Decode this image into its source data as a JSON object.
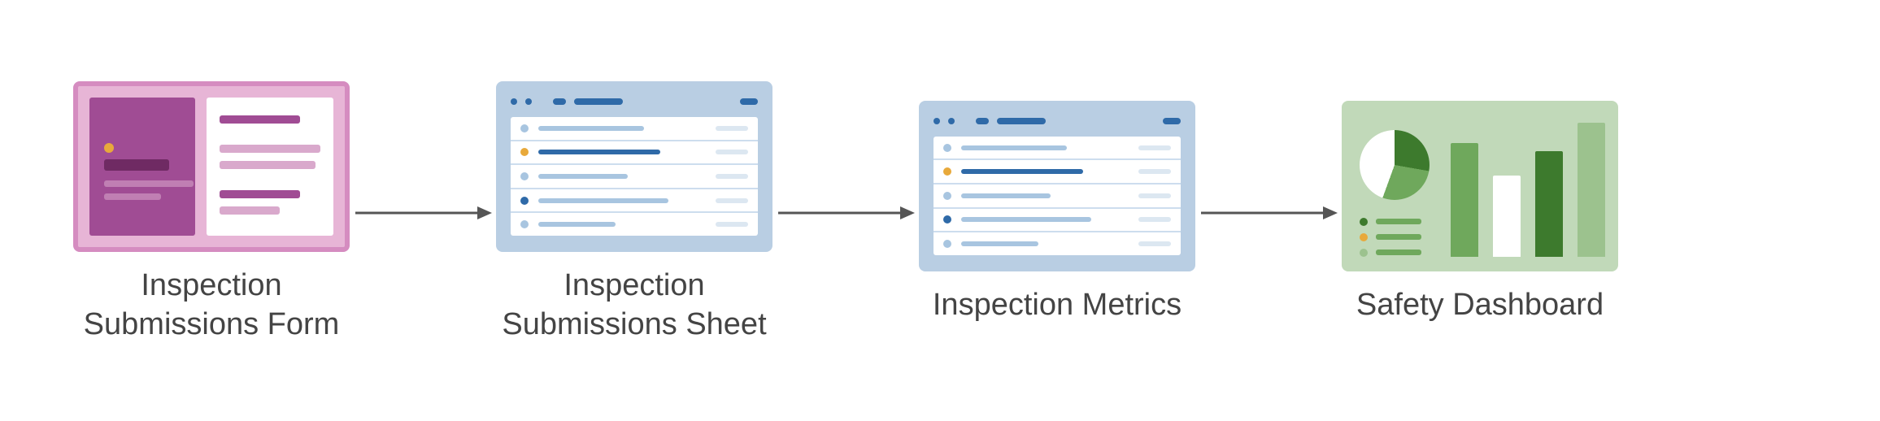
{
  "flow": {
    "nodes": [
      {
        "id": "form",
        "label": "Inspection\nSubmissions Form",
        "icon": "form-icon"
      },
      {
        "id": "sheet",
        "label": "Inspection\nSubmissions Sheet",
        "icon": "spreadsheet-icon"
      },
      {
        "id": "metrics",
        "label": "Inspection Metrics",
        "icon": "spreadsheet-icon"
      },
      {
        "id": "dashboard",
        "label": "Safety Dashboard",
        "icon": "dashboard-icon"
      }
    ],
    "arrows": [
      "form→sheet",
      "sheet→metrics",
      "metrics→dashboard"
    ]
  },
  "colors": {
    "form_bg": "#e7b5d6",
    "form_accent": "#a04c94",
    "sheet_bg": "#b9cee3",
    "sheet_accent": "#2f6aa8",
    "dash_bg": "#c1d9b9",
    "dash_dark": "#3d7a2d",
    "dash_mid": "#6fa85c",
    "arrow": "#555555"
  }
}
